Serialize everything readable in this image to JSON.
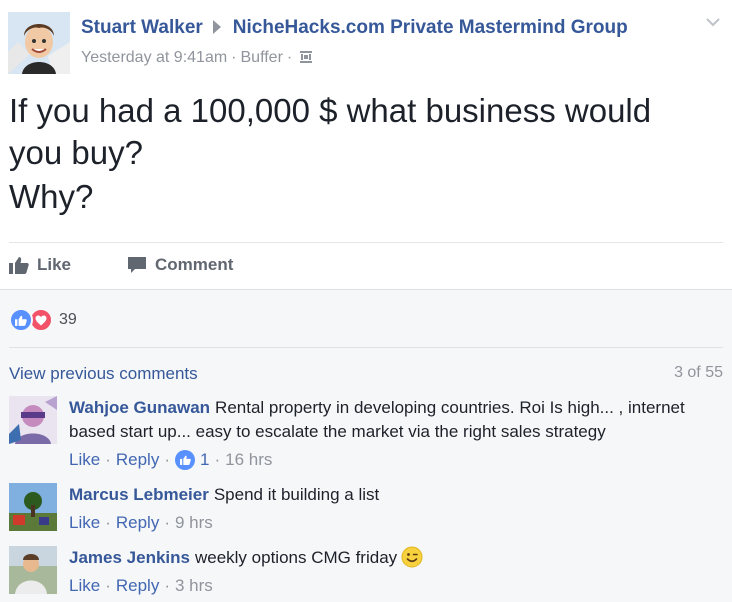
{
  "post": {
    "author": "Stuart Walker",
    "group": "NicheHacks.com Private Mastermind Group",
    "timestamp": "Yesterday at 9:41am",
    "via": "Buffer",
    "text_line1": "If you had a 100,000 $ what business would",
    "text_line2": "you buy?",
    "text_line3": "Why?",
    "privacy_icon": "group-privacy-icon",
    "menu_icon": "chevron-down-icon"
  },
  "actions": {
    "like_label": "Like",
    "comment_label": "Comment"
  },
  "reactions": {
    "count": "39",
    "types": [
      "like",
      "love"
    ]
  },
  "comments_header": {
    "view_previous": "View previous comments",
    "count_label": "3 of 55"
  },
  "comments": [
    {
      "author": "Wahjoe Gunawan",
      "text": "Rental property in developing countries. Roi Is high... , internet based start up... easy to escalate the market via the right sales strategy",
      "like_label": "Like",
      "reply_label": "Reply",
      "likes": "1",
      "time": "16 hrs"
    },
    {
      "author": "Marcus Lebmeier",
      "text": "Spend it building a list",
      "like_label": "Like",
      "reply_label": "Reply",
      "time": "9 hrs"
    },
    {
      "author": "James Jenkins",
      "text": "weekly options CMG friday",
      "emoji": "wink-emoji",
      "like_label": "Like",
      "reply_label": "Reply",
      "time": "3 hrs"
    }
  ],
  "colors": {
    "link": "#365899",
    "like_blue": "#5890ff",
    "love_red": "#f25268",
    "muted": "#90949c",
    "comments_bg": "#f6f7f9"
  }
}
